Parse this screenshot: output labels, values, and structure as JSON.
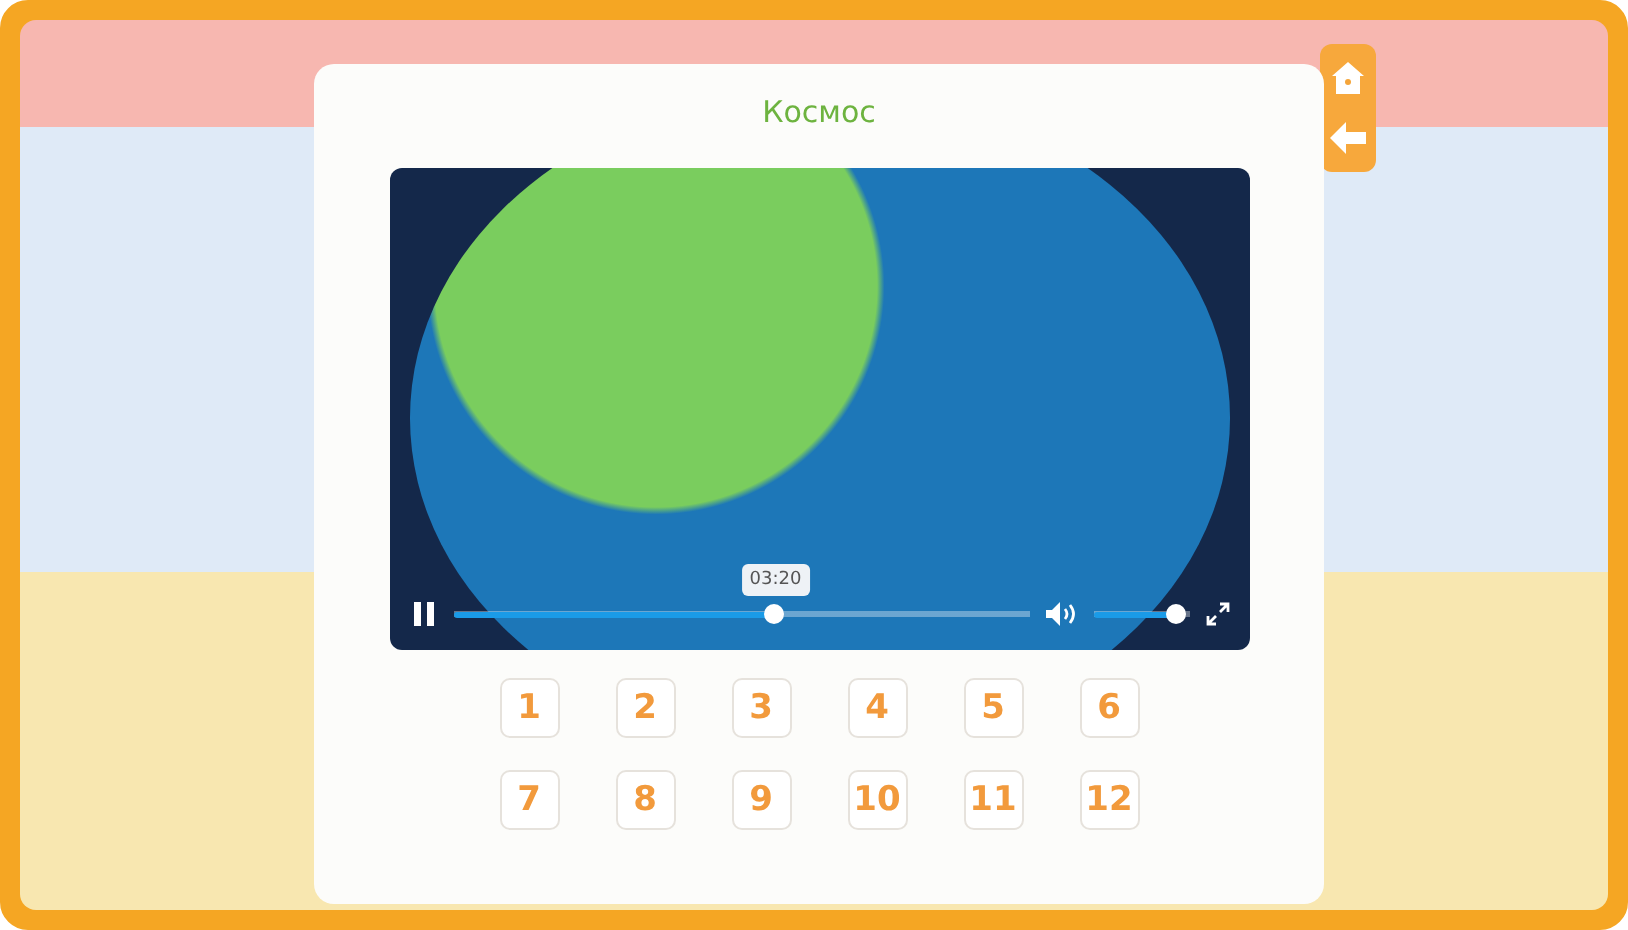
{
  "title": "Космос",
  "nav_buttons": [
    {
      "kind": "home"
    },
    {
      "kind": "back"
    }
  ],
  "video": {
    "playing": true,
    "progress": {
      "level": 0.56,
      "tooltip": "03:20"
    },
    "volume": {
      "level": 0.95
    }
  },
  "lessons": [
    "1",
    "2",
    "3",
    "4",
    "5",
    "6",
    "7",
    "8",
    "9",
    "10",
    "11",
    "12"
  ]
}
